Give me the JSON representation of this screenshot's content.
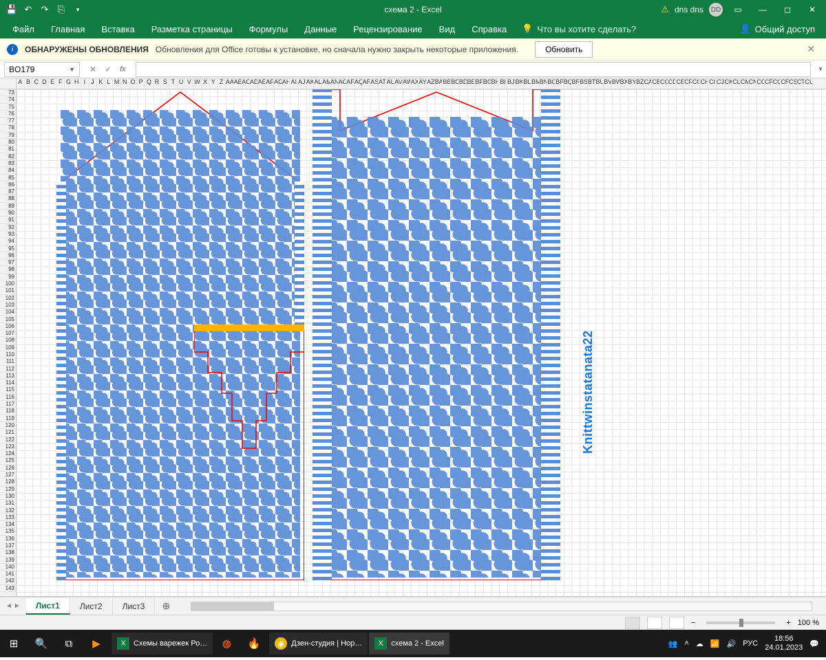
{
  "titlebar": {
    "doc_title": "схема 2  -  Excel",
    "user_name": "dns dns",
    "user_initials": "DD"
  },
  "ribbon": {
    "tabs": [
      "Файл",
      "Главная",
      "Вставка",
      "Разметка страницы",
      "Формулы",
      "Данные",
      "Рецензирование",
      "Вид",
      "Справка"
    ],
    "tellme_placeholder": "Что вы хотите сделать?",
    "share_label": "Общий доступ"
  },
  "messagebar": {
    "title": "ОБНАРУЖЕНЫ ОБНОВЛЕНИЯ",
    "text": "Обновления для Office готовы к установке, но сначала нужно закрыть некоторые приложения.",
    "button": "Обновить"
  },
  "formula": {
    "namebox_value": "BO179",
    "fx_value": ""
  },
  "grid": {
    "first_row": 73,
    "last_row": 143,
    "col_letters": [
      "A",
      "B",
      "C",
      "D",
      "E",
      "F",
      "G",
      "H",
      "I",
      "J",
      "K",
      "L",
      "M",
      "N",
      "O",
      "P",
      "Q",
      "R",
      "S",
      "T",
      "U",
      "V",
      "W",
      "X",
      "Y",
      "Z",
      "AA",
      "AB",
      "AC",
      "AD",
      "AE",
      "AF",
      "AG",
      "AH",
      "AI",
      "AJ",
      "AK",
      "AL",
      "AM",
      "AN",
      "AO",
      "AP",
      "AQ",
      "AR",
      "AS",
      "AT",
      "AU",
      "AV",
      "AW",
      "AX",
      "AY",
      "AZ",
      "BA",
      "BB",
      "BC",
      "BD",
      "BE",
      "BF",
      "BG",
      "BH",
      "BI",
      "BJ",
      "BK",
      "BL",
      "BM",
      "BN",
      "BO",
      "BP",
      "BQ",
      "BR",
      "BS",
      "BT",
      "BU",
      "BV",
      "BW",
      "BX",
      "BY",
      "BZ",
      "CA",
      "CB",
      "CC",
      "CD",
      "CE",
      "CF",
      "CG",
      "CH",
      "CI",
      "CJ",
      "CK",
      "CL",
      "CM",
      "CN",
      "CO",
      "CP",
      "CQ",
      "CR",
      "CS",
      "CT",
      "CU"
    ],
    "active_cell": "BO179",
    "watermark": "Knittwinstatanata22"
  },
  "sheets": {
    "tabs": [
      "Лист1",
      "Лист2",
      "Лист3"
    ],
    "active_index": 0
  },
  "statusbar": {
    "zoom_label": "100 %"
  },
  "taskbar": {
    "apps": [
      {
        "label": "Схемы варежек Ро…",
        "icon": "x"
      },
      {
        "label": "",
        "icon": "orange"
      },
      {
        "label": "",
        "icon": "red"
      },
      {
        "label": "Дзен-студия | Нор…",
        "icon": "chrome"
      },
      {
        "label": "схема 2 - Excel",
        "icon": "x",
        "active": true
      }
    ],
    "lang": "РУС",
    "time": "18:56",
    "date": "24.01.2023"
  }
}
